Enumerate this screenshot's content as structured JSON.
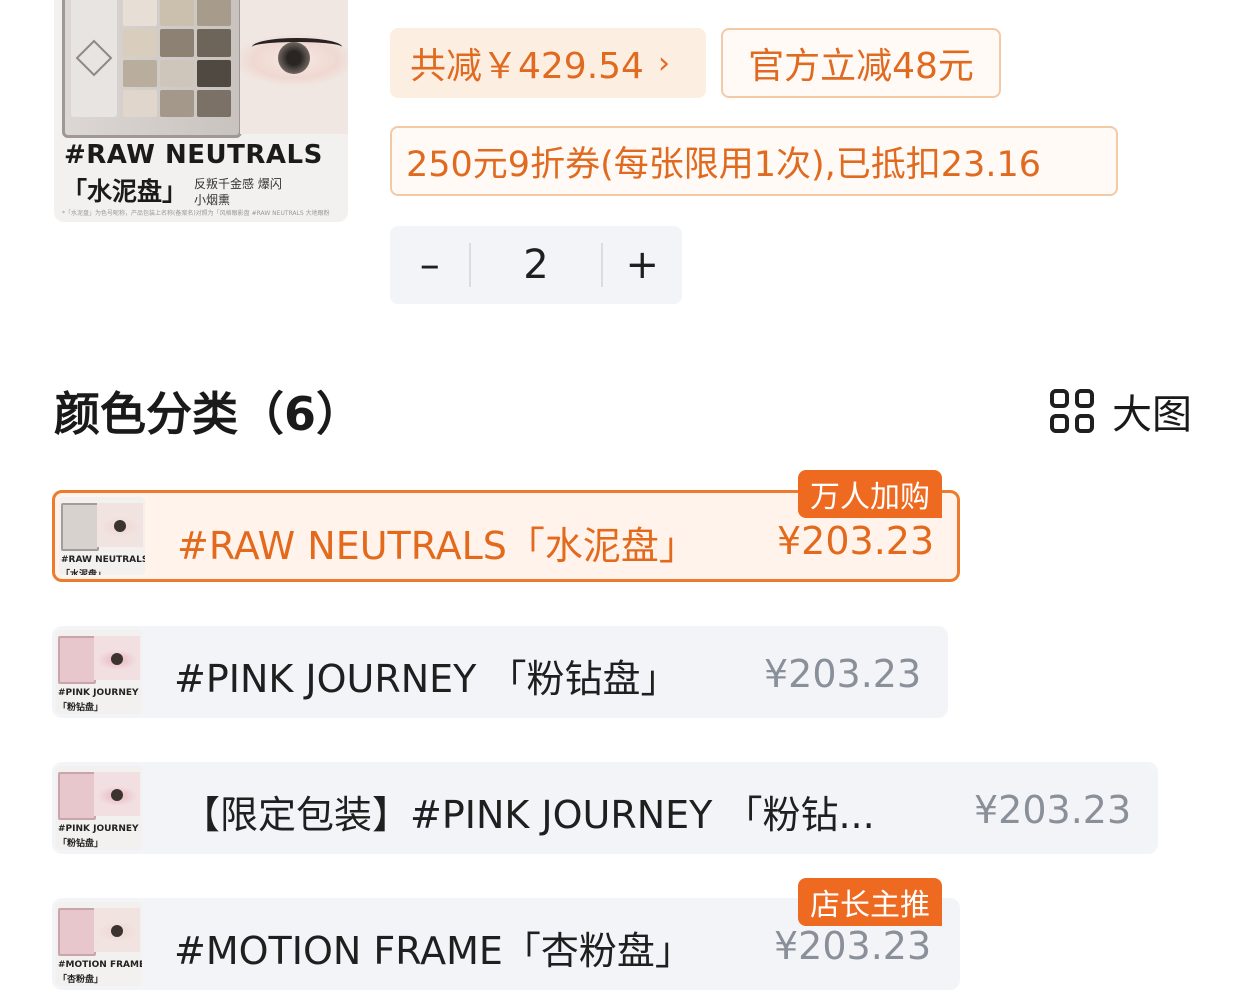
{
  "product_image": {
    "title": "#RAW NEUTRALS",
    "subtitle": "「水泥盘」",
    "tagline": "反叛千金感 爆闪小烟熏",
    "fineprint": "*「水泥盘」为色号昵称，产品包装上名称(备案名)对照为「风格眼影盘 #RAW NEUTRALS 大地眼粉"
  },
  "promo": {
    "total_discount": "共减￥429.54",
    "total_chevron": "›",
    "official_discount": "官方立减48元",
    "coupon": "250元9折券(每张限用1次),已抵扣23.16"
  },
  "quantity": {
    "minus": "–",
    "value": "2",
    "plus": "+"
  },
  "section": {
    "title": "颜色分类（6）",
    "big_view_label": "大图"
  },
  "variants": [
    {
      "name": "#RAW NEUTRALS「水泥盘」",
      "price": "¥203.23",
      "badge": "万人加购",
      "selected": true,
      "thumb_title": "#RAW NEUTRALS",
      "thumb_sub": "「水泥盘」"
    },
    {
      "name": "#PINK JOURNEY 「粉钻盘」",
      "price": "¥203.23",
      "badge": "",
      "selected": false,
      "thumb_title": "#PINK JOURNEY",
      "thumb_sub": "「粉钻盘」"
    },
    {
      "name": "【限定包装】#PINK JOURNEY 「粉钻...",
      "price": "¥203.23",
      "badge": "",
      "selected": false,
      "thumb_title": "#PINK JOURNEY",
      "thumb_sub": "「粉钻盘」"
    },
    {
      "name": "#MOTION FRAME「杏粉盘」",
      "price": "¥203.23",
      "badge": "店长主推",
      "selected": false,
      "thumb_title": "#MOTION FRAME",
      "thumb_sub": "「杏粉盘」"
    }
  ],
  "colors": {
    "accent": "#ee7a2d",
    "accent_text": "#e36a1d",
    "row_bg": "#f2f4f7",
    "selected_bg": "#fff3ec",
    "price_gray": "#8a9099"
  }
}
